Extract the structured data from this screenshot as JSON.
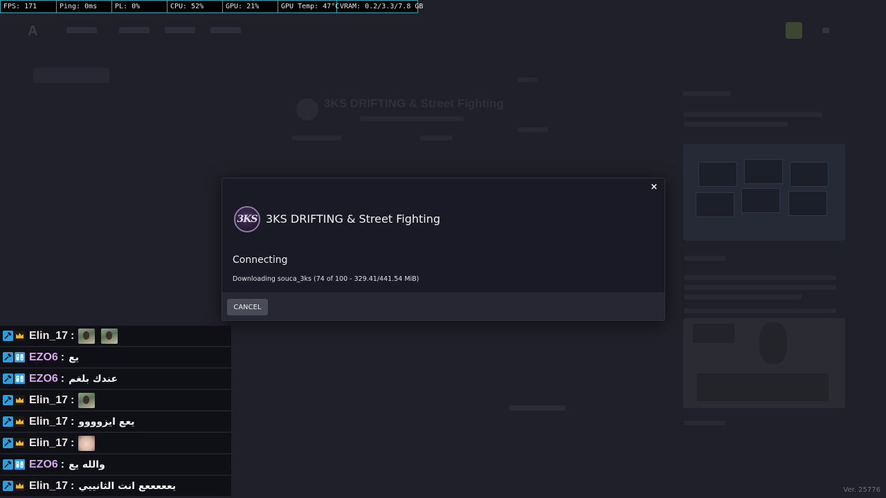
{
  "perf_overlay": {
    "fps": "FPS: 171",
    "ping": "Ping: 0ms",
    "pl": "PL: 0%",
    "cpu": "CPU: 52%",
    "gpu": "GPU: 21%",
    "gpu_temp": "GPU Temp: 47°C",
    "vram": "VRAM: 0.2/3.3/7.8 GB"
  },
  "modal": {
    "close_glyph": "×",
    "server_icon_text": "3KS",
    "server_name": "3KS DRIFTING & Street Fighting",
    "status": "Connecting",
    "progress": "Downloading souca_3ks (74 of 100 - 329.41/441.54 MiB)",
    "cancel_label": "CANCEL"
  },
  "background": {
    "server_header": "3KS DRIFTING & Street Fighting",
    "logo": "A"
  },
  "chat": [
    {
      "name": "Elin_17",
      "sep": ":",
      "message": "",
      "emotes": 2,
      "kind": "elin"
    },
    {
      "name": "EZO6",
      "sep": ":",
      "message": "يع",
      "emotes": 0,
      "kind": "ezo"
    },
    {
      "name": "EZO6",
      "sep": ":",
      "message": "عندك بلغم",
      "emotes": 0,
      "kind": "ezo"
    },
    {
      "name": "Elin_17",
      "sep": ":",
      "message": "",
      "emotes": 1,
      "kind": "elin"
    },
    {
      "name": "Elin_17",
      "sep": ":",
      "message": "يعع ايزوووو",
      "emotes": 0,
      "kind": "elin"
    },
    {
      "name": "Elin_17",
      "sep": ":",
      "message": "",
      "emotes": 1,
      "kind": "elin-face"
    },
    {
      "name": "EZO6",
      "sep": ":",
      "message": "والله يع",
      "emotes": 0,
      "kind": "ezo"
    },
    {
      "name": "Elin_17",
      "sep": ":",
      "message": "يعععععع انت الثانييي",
      "emotes": 0,
      "kind": "elin"
    }
  ],
  "icons": {
    "mod_badge": "hammer-icon",
    "crown_badge": "crown-icon",
    "nitro_badge": "gamepad-icon",
    "close": "close-icon"
  },
  "colors": {
    "modal_bg": "#191a25",
    "accent_cyan": "#35a8b8",
    "ezo_name": "#d9a6f0",
    "elin_name": "#f1e8e3"
  },
  "version": "Ver. 25776"
}
